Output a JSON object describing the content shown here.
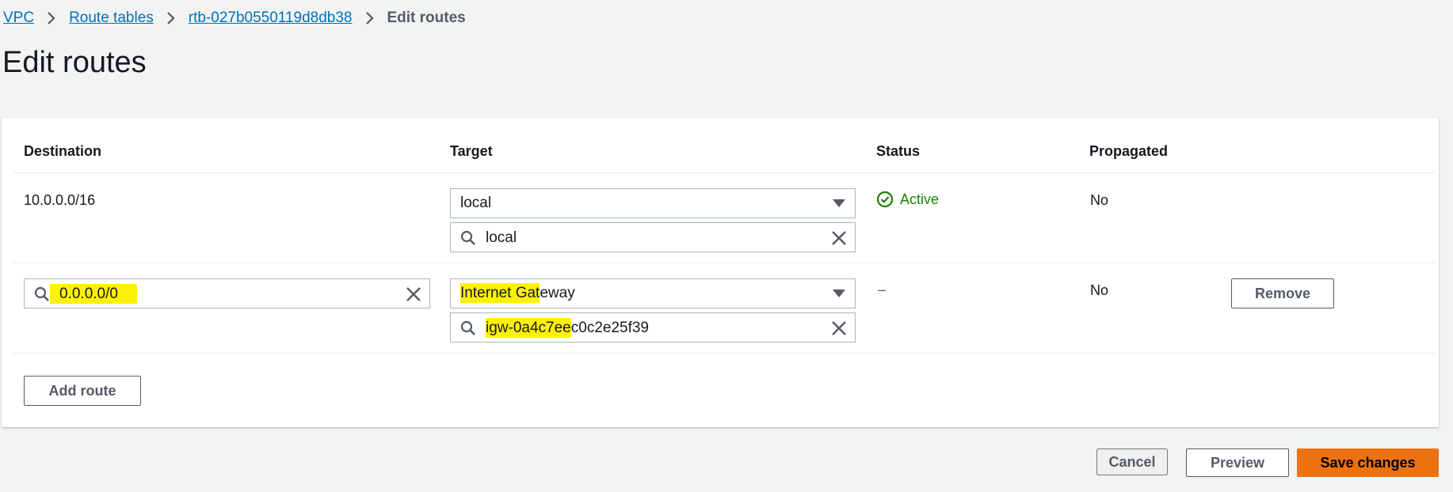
{
  "breadcrumb": {
    "items": [
      "VPC",
      "Route tables",
      "rtb-027b0550119d8db38"
    ],
    "current": "Edit routes"
  },
  "page": {
    "title": "Edit routes"
  },
  "table": {
    "headers": {
      "destination": "Destination",
      "target": "Target",
      "status": "Status",
      "propagated": "Propagated"
    },
    "rows": [
      {
        "destination": "10.0.0.0/16",
        "target_type": "local",
        "target_value": "local",
        "status": "Active",
        "propagated": "No"
      },
      {
        "destination_hl": "0.0.0.0/0",
        "target_type_hl": "Internet Gat",
        "target_type_rest": "eway",
        "target_value_hl": "igw-0a4c7ee",
        "target_value_rest": "c0c2e25f39",
        "status": "–",
        "propagated": "No",
        "remove_label": "Remove"
      }
    ]
  },
  "actions": {
    "add_route": "Add route",
    "cancel": "Cancel",
    "preview": "Preview",
    "save": "Save changes"
  },
  "colors": {
    "link": "#0073bb",
    "success": "#1d8102",
    "primary": "#ec7211",
    "highlight": "#fff200"
  }
}
